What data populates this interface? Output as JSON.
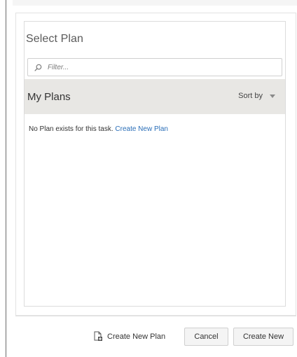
{
  "dialog": {
    "title": "Select Plan",
    "filter": {
      "placeholder": "Filter...",
      "value": ""
    },
    "section": {
      "title": "My Plans",
      "sort_label": "Sort by"
    },
    "empty_state": {
      "message": "No Plan exists for this task.",
      "link_label": "Create New Plan"
    }
  },
  "footer": {
    "create_new_plan_label": "Create New Plan",
    "cancel_label": "Cancel",
    "create_new_label": "Create New"
  },
  "icons": {
    "filter": "search-icon",
    "sort": "chevron-down-icon",
    "create_plan": "new-document-icon"
  },
  "colors": {
    "link": "#2a6eb8",
    "header_background": "#e8e7e4"
  }
}
